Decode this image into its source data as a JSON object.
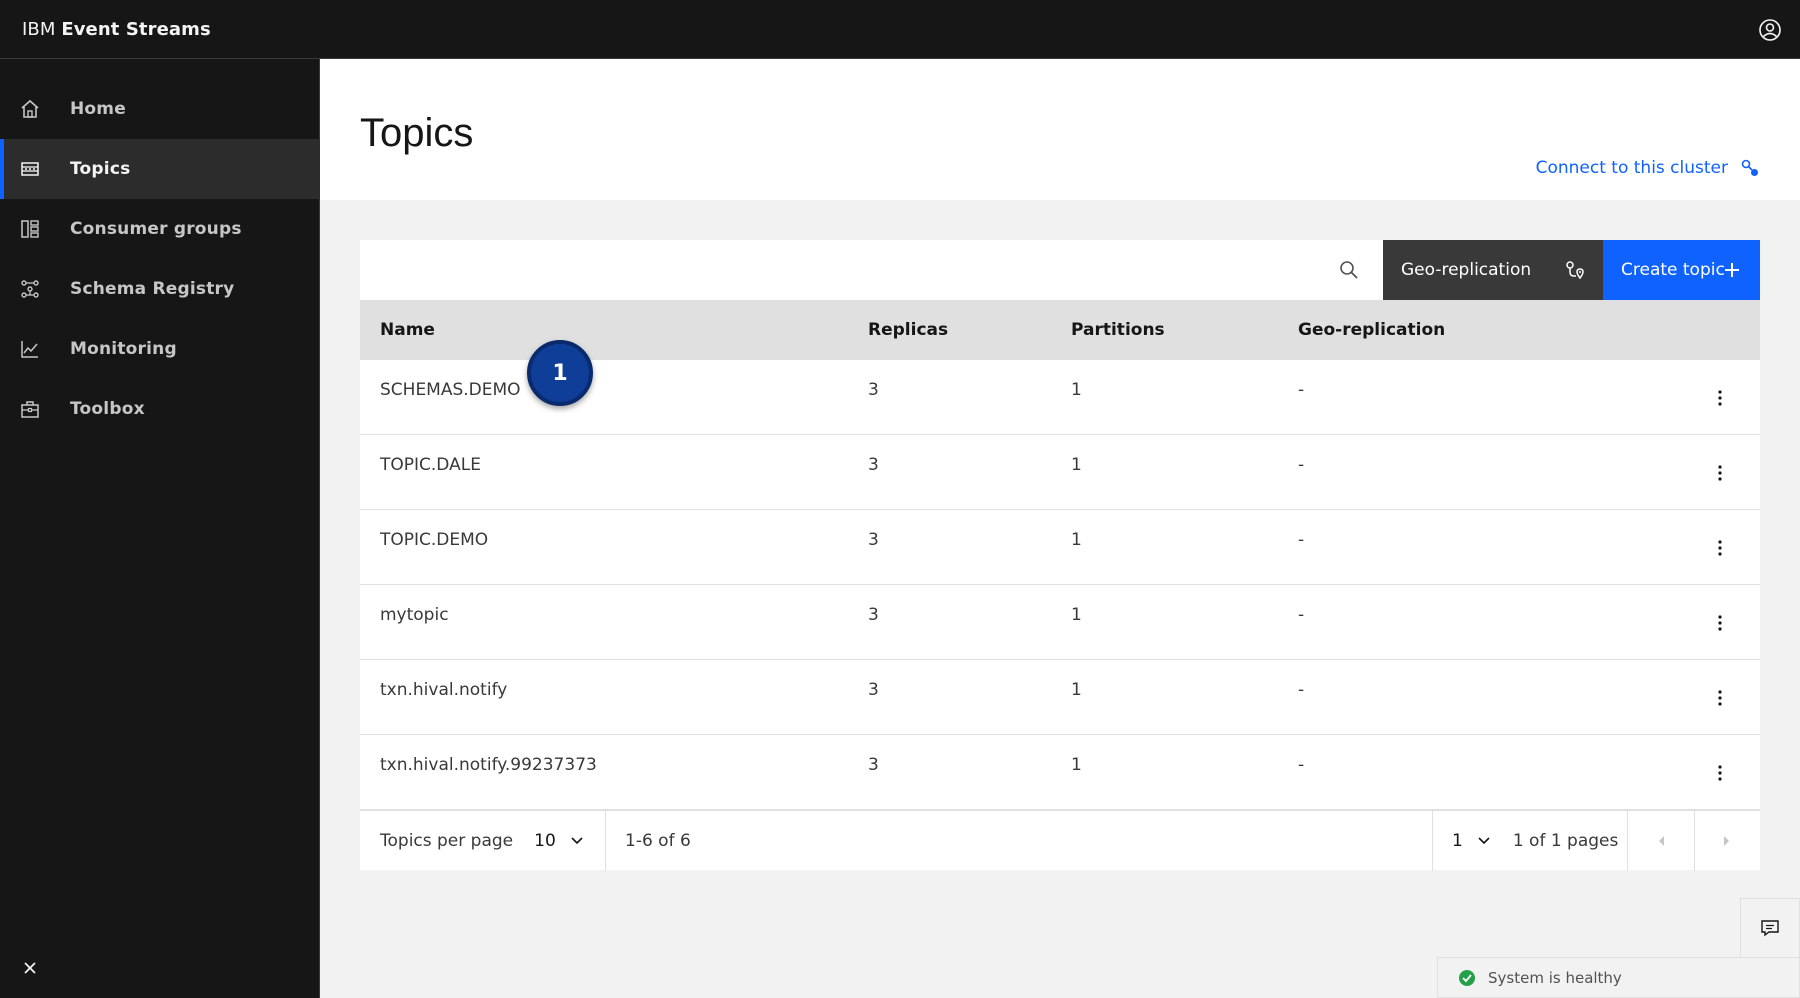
{
  "header": {
    "brand_prefix": "IBM",
    "brand_name": "Event Streams",
    "user_icon": "user-avatar-icon"
  },
  "sidebar": {
    "items": [
      {
        "label": "Home",
        "icon": "home-icon",
        "active": false
      },
      {
        "label": "Topics",
        "icon": "topics-icon",
        "active": true
      },
      {
        "label": "Consumer groups",
        "icon": "consumer-groups-icon",
        "active": false
      },
      {
        "label": "Schema Registry",
        "icon": "schema-registry-icon",
        "active": false
      },
      {
        "label": "Monitoring",
        "icon": "monitoring-icon",
        "active": false
      },
      {
        "label": "Toolbox",
        "icon": "toolbox-icon",
        "active": false
      }
    ],
    "collapse_icon": "close-icon"
  },
  "page": {
    "title": "Topics",
    "connect_label": "Connect to this cluster"
  },
  "toolbar": {
    "search_placeholder": "",
    "geo_label": "Geo-replication",
    "create_label": "Create topic"
  },
  "table": {
    "headers": [
      "Name",
      "Replicas",
      "Partitions",
      "Geo-replication"
    ],
    "rows": [
      {
        "name": "SCHEMAS.DEMO",
        "replicas": "3",
        "partitions": "1",
        "geo": "-"
      },
      {
        "name": "TOPIC.DALE",
        "replicas": "3",
        "partitions": "1",
        "geo": "-"
      },
      {
        "name": "TOPIC.DEMO",
        "replicas": "3",
        "partitions": "1",
        "geo": "-"
      },
      {
        "name": "mytopic",
        "replicas": "3",
        "partitions": "1",
        "geo": "-"
      },
      {
        "name": "txn.hival.notify",
        "replicas": "3",
        "partitions": "1",
        "geo": "-"
      },
      {
        "name": "txn.hival.notify.99237373",
        "replicas": "3",
        "partitions": "1",
        "geo": "-"
      }
    ]
  },
  "pagination": {
    "per_page_label": "Topics per page",
    "per_page_value": "10",
    "range_label": "1-6 of 6",
    "page_value": "1",
    "pages_label": "1 of 1 pages"
  },
  "callout": {
    "number": "1"
  },
  "status": {
    "label": "System is healthy",
    "color": "#24a148"
  },
  "colors": {
    "accent": "#0f62fe",
    "sidebar_bg": "#161616",
    "geo_btn_bg": "#393939"
  }
}
